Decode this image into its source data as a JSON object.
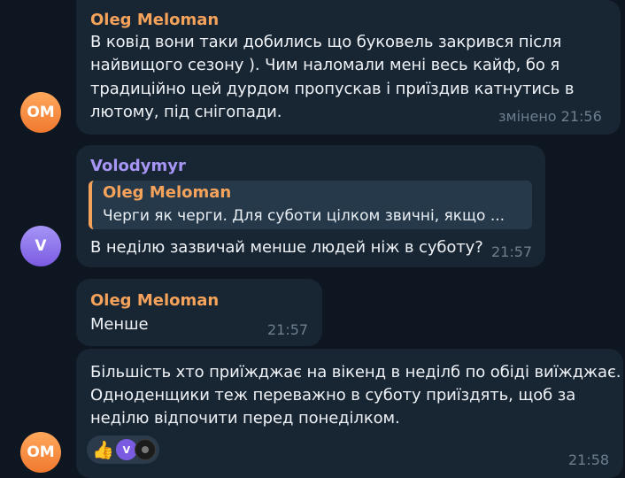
{
  "messages": [
    {
      "sender": "Oleg Meloman",
      "avatar_initials": "OM",
      "lines": [
        "В ковід вони таки добились що буковель закрився після",
        "найвищого сезону ). Чим наломали мені весь кайф, бо я",
        "традиційно цей дурдом пропускав і приїздив катнутись в",
        "лютому, під снігопади."
      ],
      "time": "змінено 21:56"
    },
    {
      "sender": "Volodymyr",
      "avatar_initials": "V",
      "reply": {
        "name": "Oleg Meloman",
        "text": "Черги як черги. Для суботи цілком звичні, якщо ..."
      },
      "lines": [
        "В неділю зазвичай менше людей ніж в суботу?"
      ],
      "time": "21:57"
    },
    {
      "sender": "Oleg Meloman",
      "lines": [
        "Менше"
      ],
      "time": "21:57"
    },
    {
      "avatar_initials": "OM",
      "lines": [
        "Більшість хто приїжджає на вікенд в неділб по обіді виїжджає.",
        "Одноденщики теж переважно в суботу приїздять, щоб за",
        "неділю відпочити перед понеділком."
      ],
      "reactions": {
        "emoji": "👍",
        "avatar_initial": "V"
      },
      "time": "21:58"
    }
  ],
  "colors": {
    "background": "#0e1621",
    "bubble": "#182533",
    "oleg_name": "#f5a25b",
    "volodymyr_name": "#a796f5",
    "time": "#6d7f8f"
  }
}
